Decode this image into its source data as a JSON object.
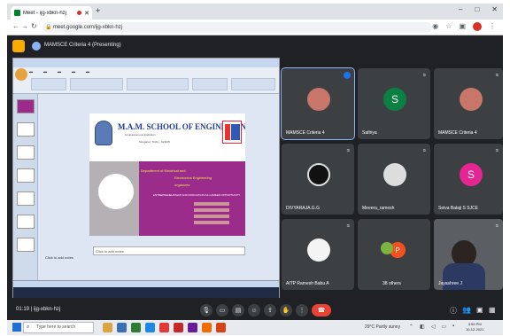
{
  "browser": {
    "tab_title": "Meet - ijg-xbkn-hzj",
    "new_tab": "+",
    "url": "meet.google.com/ijg-xbkn-hzj",
    "win_controls": [
      "–",
      "□",
      "✕"
    ]
  },
  "meet": {
    "presenting_label": "MAMSCE Criteria 4 (Presenting)"
  },
  "slide": {
    "school_name": "M.A.M. SCHOOL OF ENGINEERING",
    "school_sub": "An autonomous institution",
    "school_sub2": "Siruganur, Trichy - 621105",
    "line1": "Department of Electrical and",
    "line2": "Electronics Engineering",
    "line3": "organizes",
    "line4": "ENTREPRENEURSHIP AND INNOVATION AS CAREER OPPORTUNITY",
    "click_to_add": "Click to add notes",
    "notes_tip": "Click to add notes"
  },
  "participants": [
    {
      "name": "MAMSCE Criteria 4",
      "initial": "",
      "color": "#5f6368",
      "type": "photo"
    },
    {
      "name": "Sathiya",
      "initial": "S",
      "color": "#0b8043",
      "type": "letter"
    },
    {
      "name": "MAMSCE Criteria 4",
      "initial": "",
      "color": "#5f6368",
      "type": "photo"
    },
    {
      "name": "DIVYARAJA.G.G",
      "initial": "",
      "color": "#1a1a1a",
      "type": "photo"
    },
    {
      "name": "Meeera_ramesh",
      "initial": "",
      "color": "#2a2a2a",
      "type": "photo"
    },
    {
      "name": "Seiva Balaji S SJCE",
      "initial": "S",
      "color": "#e52592",
      "type": "letter"
    },
    {
      "name": "AITP Ramesh Babu A",
      "initial": "",
      "color": "#f1f1f1",
      "type": "photo"
    },
    {
      "name": "38 others",
      "initial": "P",
      "color": "#f4511e",
      "type": "letter"
    },
    {
      "name": "Jayashree J",
      "initial": "",
      "color": "#4a4a4a",
      "type": "video"
    }
  ],
  "controls": {
    "meeting_code": "01:19  |  ijg-xbkn-hzj"
  },
  "taskbar": {
    "search_placeholder": "Type here to search",
    "weather": "29°C  Partly sunny",
    "time": "3:50 PM",
    "date": "10-12-2021"
  }
}
